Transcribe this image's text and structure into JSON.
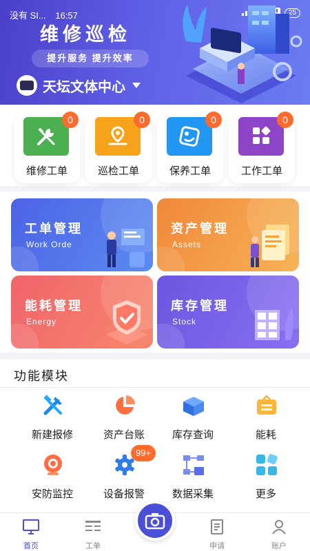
{
  "status_bar": {
    "carrier": "没有 SI...",
    "time": "16:57",
    "battery": "25"
  },
  "header": {
    "title": "维修巡检",
    "slogan": "提升服务 提升效率",
    "site_name": "天坛文体中心"
  },
  "work_orders": [
    {
      "label": "维修工单",
      "count": "0",
      "icon": "wrench-screwdriver-icon",
      "color": "#4caf50"
    },
    {
      "label": "巡检工单",
      "count": "0",
      "icon": "location-pin-icon",
      "color": "#f7a21b"
    },
    {
      "label": "保养工单",
      "count": "0",
      "icon": "maintenance-tag-icon",
      "color": "#2196f3"
    },
    {
      "label": "工作工单",
      "count": "0",
      "icon": "grid-blocks-icon",
      "color": "#8e44c7"
    }
  ],
  "management": [
    {
      "title": "工单管理",
      "subtitle": "Work Orde",
      "color_from": "#4d63e6",
      "color_to": "#5b8bf0"
    },
    {
      "title": "资产管理",
      "subtitle": "Assets",
      "color_from": "#f0883a",
      "color_to": "#f7b356"
    },
    {
      "title": "能耗管理",
      "subtitle": "Energy",
      "color_from": "#f0646a",
      "color_to": "#f7886d"
    },
    {
      "title": "库存管理",
      "subtitle": "Stock",
      "color_from": "#6a57e0",
      "color_to": "#8a6ff0"
    }
  ],
  "modules": {
    "title": "功能模块",
    "items": [
      {
        "label": "新建报修",
        "icon": "tools-icon"
      },
      {
        "label": "资产台账",
        "icon": "pie-chart-icon"
      },
      {
        "label": "库存查询",
        "icon": "box-icon"
      },
      {
        "label": "能耗",
        "icon": "sign-board-icon"
      },
      {
        "label": "安防监控",
        "icon": "webcam-icon"
      },
      {
        "label": "设备报警",
        "icon": "gear-icon",
        "badge": "99+"
      },
      {
        "label": "数据采集",
        "icon": "flowchart-icon"
      },
      {
        "label": "更多",
        "icon": "more-grid-icon"
      }
    ]
  },
  "bottom_nav": {
    "items": [
      {
        "label": "首页",
        "icon": "monitor-icon",
        "active": true
      },
      {
        "label": "工单",
        "icon": "orders-icon",
        "active": false
      },
      {
        "label": "申请",
        "icon": "document-icon",
        "active": false
      },
      {
        "label": "账户",
        "icon": "user-icon",
        "active": false
      }
    ],
    "center_icon": "camera-icon"
  },
  "colors": {
    "accent": "#4b4fd8",
    "badge": "#ff6b2c"
  }
}
